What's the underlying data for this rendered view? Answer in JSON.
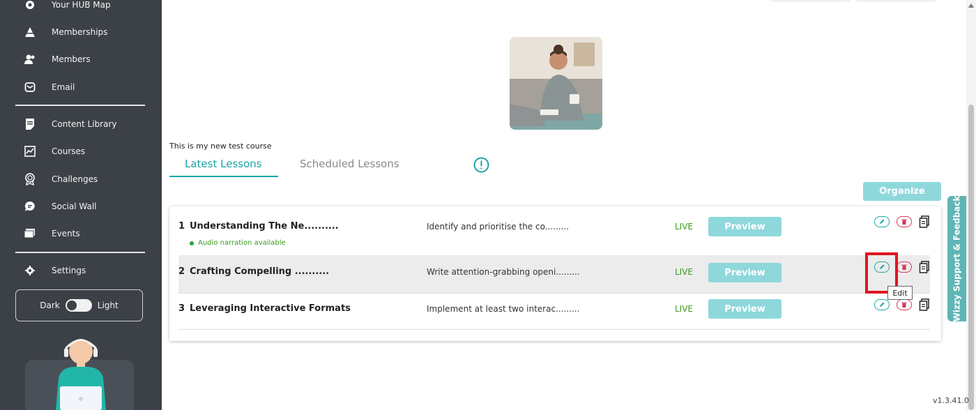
{
  "sidebar": {
    "items_top": [
      {
        "label": "Your HUB Map",
        "icon": "gear-badge-icon"
      },
      {
        "label": "Memberships",
        "icon": "pyramid-icon"
      },
      {
        "label": "Members",
        "icon": "users-icon"
      },
      {
        "label": "Email",
        "icon": "mail-icon"
      }
    ],
    "items_mid": [
      {
        "label": "Content Library",
        "icon": "document-icon"
      },
      {
        "label": "Courses",
        "icon": "chart-board-icon"
      },
      {
        "label": "Challenges",
        "icon": "award-icon"
      },
      {
        "label": "Social Wall",
        "icon": "chat-bubble-icon"
      },
      {
        "label": "Events",
        "icon": "calendar-stack-icon"
      }
    ],
    "items_bottom": [
      {
        "label": "Settings",
        "icon": "gear-icon"
      }
    ],
    "theme": {
      "dark_label": "Dark",
      "light_label": "Light"
    }
  },
  "course": {
    "description": "This is my new test course"
  },
  "tabs": {
    "latest": "Latest Lessons",
    "scheduled": "Scheduled Lessons"
  },
  "organize_label": "Organize",
  "lessons": [
    {
      "number": "1",
      "title": "Understanding The Ne..........",
      "description": "Identify and prioritise the co.........",
      "status": "LIVE",
      "preview_label": "Preview",
      "note": "Audio narration available"
    },
    {
      "number": "2",
      "title": "Crafting Compelling ..........",
      "description": "Write attention-grabbing openi.........",
      "status": "LIVE",
      "preview_label": "Preview"
    },
    {
      "number": "3",
      "title": "Leveraging Interactive Formats",
      "description": "Implement at least two interac.........",
      "status": "LIVE",
      "preview_label": "Preview"
    }
  ],
  "tooltip": "Edit",
  "feedback_label": "Wizzy Support & Feedback",
  "version": "v1.3.41.0",
  "colors": {
    "sidebar_bg": "#3c4147",
    "accent": "#1aa6a6",
    "button_bg": "#8ed8dc",
    "live": "#3a9a1d",
    "delete": "#d6365a",
    "highlight": "#e0141e"
  }
}
